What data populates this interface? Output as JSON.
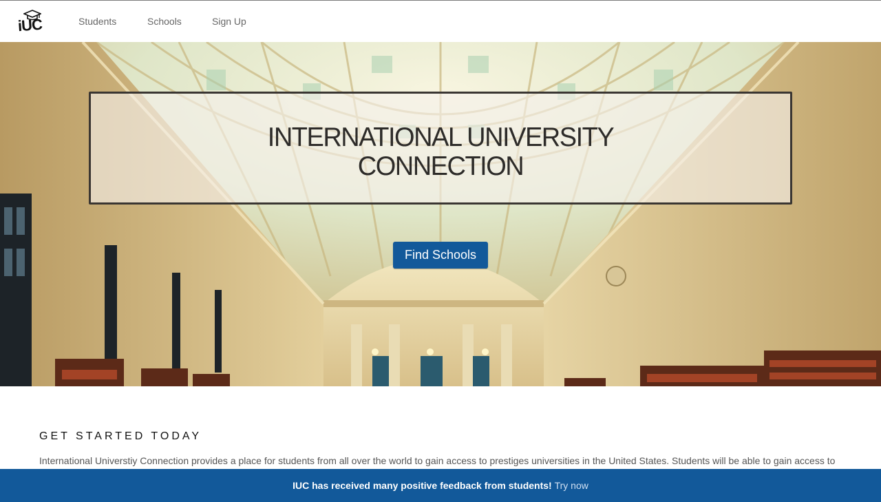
{
  "navbar": {
    "logo_text": "iUC",
    "links": [
      "Students",
      "Schools",
      "Sign Up"
    ]
  },
  "hero": {
    "title_line_1": "INTERNATIONAL UNIVERSITY",
    "title_line_2": "CONNECTION",
    "button_label": "Find Schools"
  },
  "get_started": {
    "heading": "GET STARTED TODAY",
    "text": "International Universtiy Connection provides a place for students from all over the world to gain access to prestiges universities in the United States. Students will be able to gain access to"
  },
  "banner": {
    "message": "IUC has received many positive feedback from students!",
    "link": "Try now"
  },
  "colors": {
    "accent": "#12599a",
    "nav_text": "#666666"
  }
}
